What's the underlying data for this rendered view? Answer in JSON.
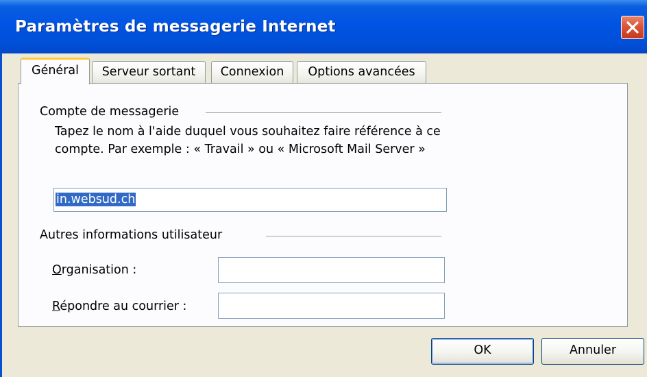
{
  "window": {
    "title": "Paramètres de messagerie Internet",
    "close_icon": "close-icon"
  },
  "tabs": [
    {
      "label": "Général",
      "active": true
    },
    {
      "label": "Serveur sortant",
      "active": false
    },
    {
      "label": "Connexion",
      "active": false
    },
    {
      "label": "Options avancées",
      "active": false
    }
  ],
  "account_group": {
    "label": "Compte de messagerie",
    "description": "Tapez le nom à l'aide duquel vous souhaitez faire référence à ce compte. Par exemple : « Travail » ou « Microsoft Mail Server »",
    "account_name_value": "in.websud.ch"
  },
  "user_info_group": {
    "label": "Autres informations utilisateur",
    "organization_label": "Organisation :",
    "organization_value": "",
    "reply_to_label": "Répondre au courrier :",
    "reply_to_value": ""
  },
  "buttons": {
    "ok_label": "OK",
    "cancel_label": "Annuler"
  },
  "colors": {
    "titlebar": "#0054e3",
    "dialog_bg": "#ece9d8",
    "active_tab_accent": "#ffc83c",
    "selection": "#316ac5"
  }
}
